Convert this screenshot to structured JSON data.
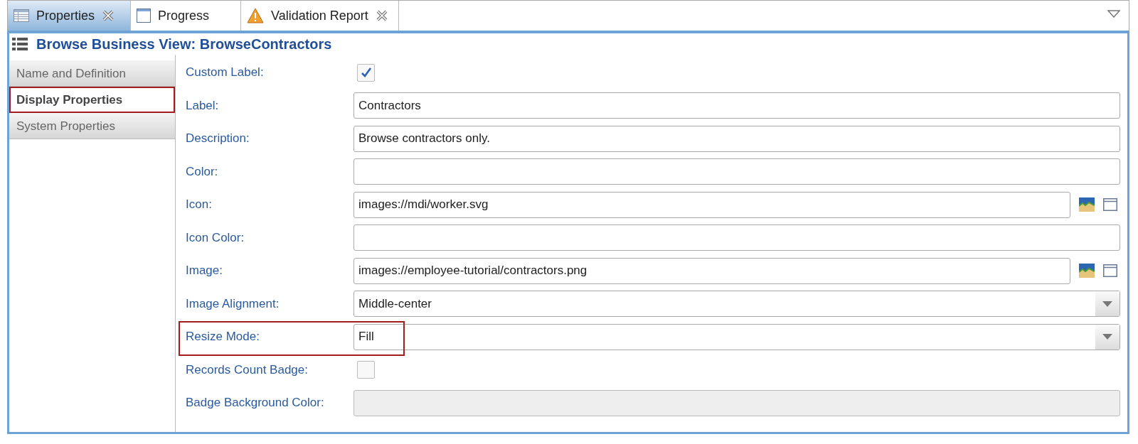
{
  "tabs": [
    {
      "label": "Properties",
      "kind": "table",
      "closable": true,
      "selected": true
    },
    {
      "label": "Progress",
      "kind": "window",
      "closable": false,
      "selected": false
    },
    {
      "label": "Validation Report",
      "kind": "warning",
      "closable": true,
      "selected": false
    }
  ],
  "header": {
    "title": "Browse Business View: BrowseContractors"
  },
  "sections": [
    {
      "label": "Name and Definition",
      "selected": false,
      "highlighted": false
    },
    {
      "label": "Display Properties",
      "selected": true,
      "highlighted": true
    },
    {
      "label": "System Properties",
      "selected": false,
      "highlighted": false
    }
  ],
  "fields": [
    {
      "kind": "checkbox",
      "label": "Custom Label:",
      "checked": true,
      "highlighted": false
    },
    {
      "kind": "text",
      "label": "Label:",
      "value": "Contractors",
      "disabled": false,
      "highlighted": false
    },
    {
      "kind": "text",
      "label": "Description:",
      "value": "Browse contractors only.",
      "disabled": false,
      "highlighted": false
    },
    {
      "kind": "text",
      "label": "Color:",
      "disabled": false,
      "highlighted": false
    },
    {
      "kind": "path",
      "label": "Icon:",
      "value": "images://mdi/worker.svg",
      "highlighted": false
    },
    {
      "kind": "text",
      "label": "Icon Color:",
      "disabled": false,
      "highlighted": false
    },
    {
      "kind": "path",
      "label": "Image:",
      "value": "images://employee-tutorial/contractors.png",
      "highlighted": false
    },
    {
      "kind": "select",
      "label": "Image Alignment:",
      "value": "Middle-center",
      "highlighted": false
    },
    {
      "kind": "select",
      "label": "Resize Mode:",
      "value": "Fill",
      "highlighted": true
    },
    {
      "kind": "checkbox",
      "label": "Records Count Badge:",
      "checked": false,
      "highlighted": false
    },
    {
      "kind": "text",
      "label": "Badge Background Color:",
      "disabled": true,
      "highlighted": false
    }
  ]
}
